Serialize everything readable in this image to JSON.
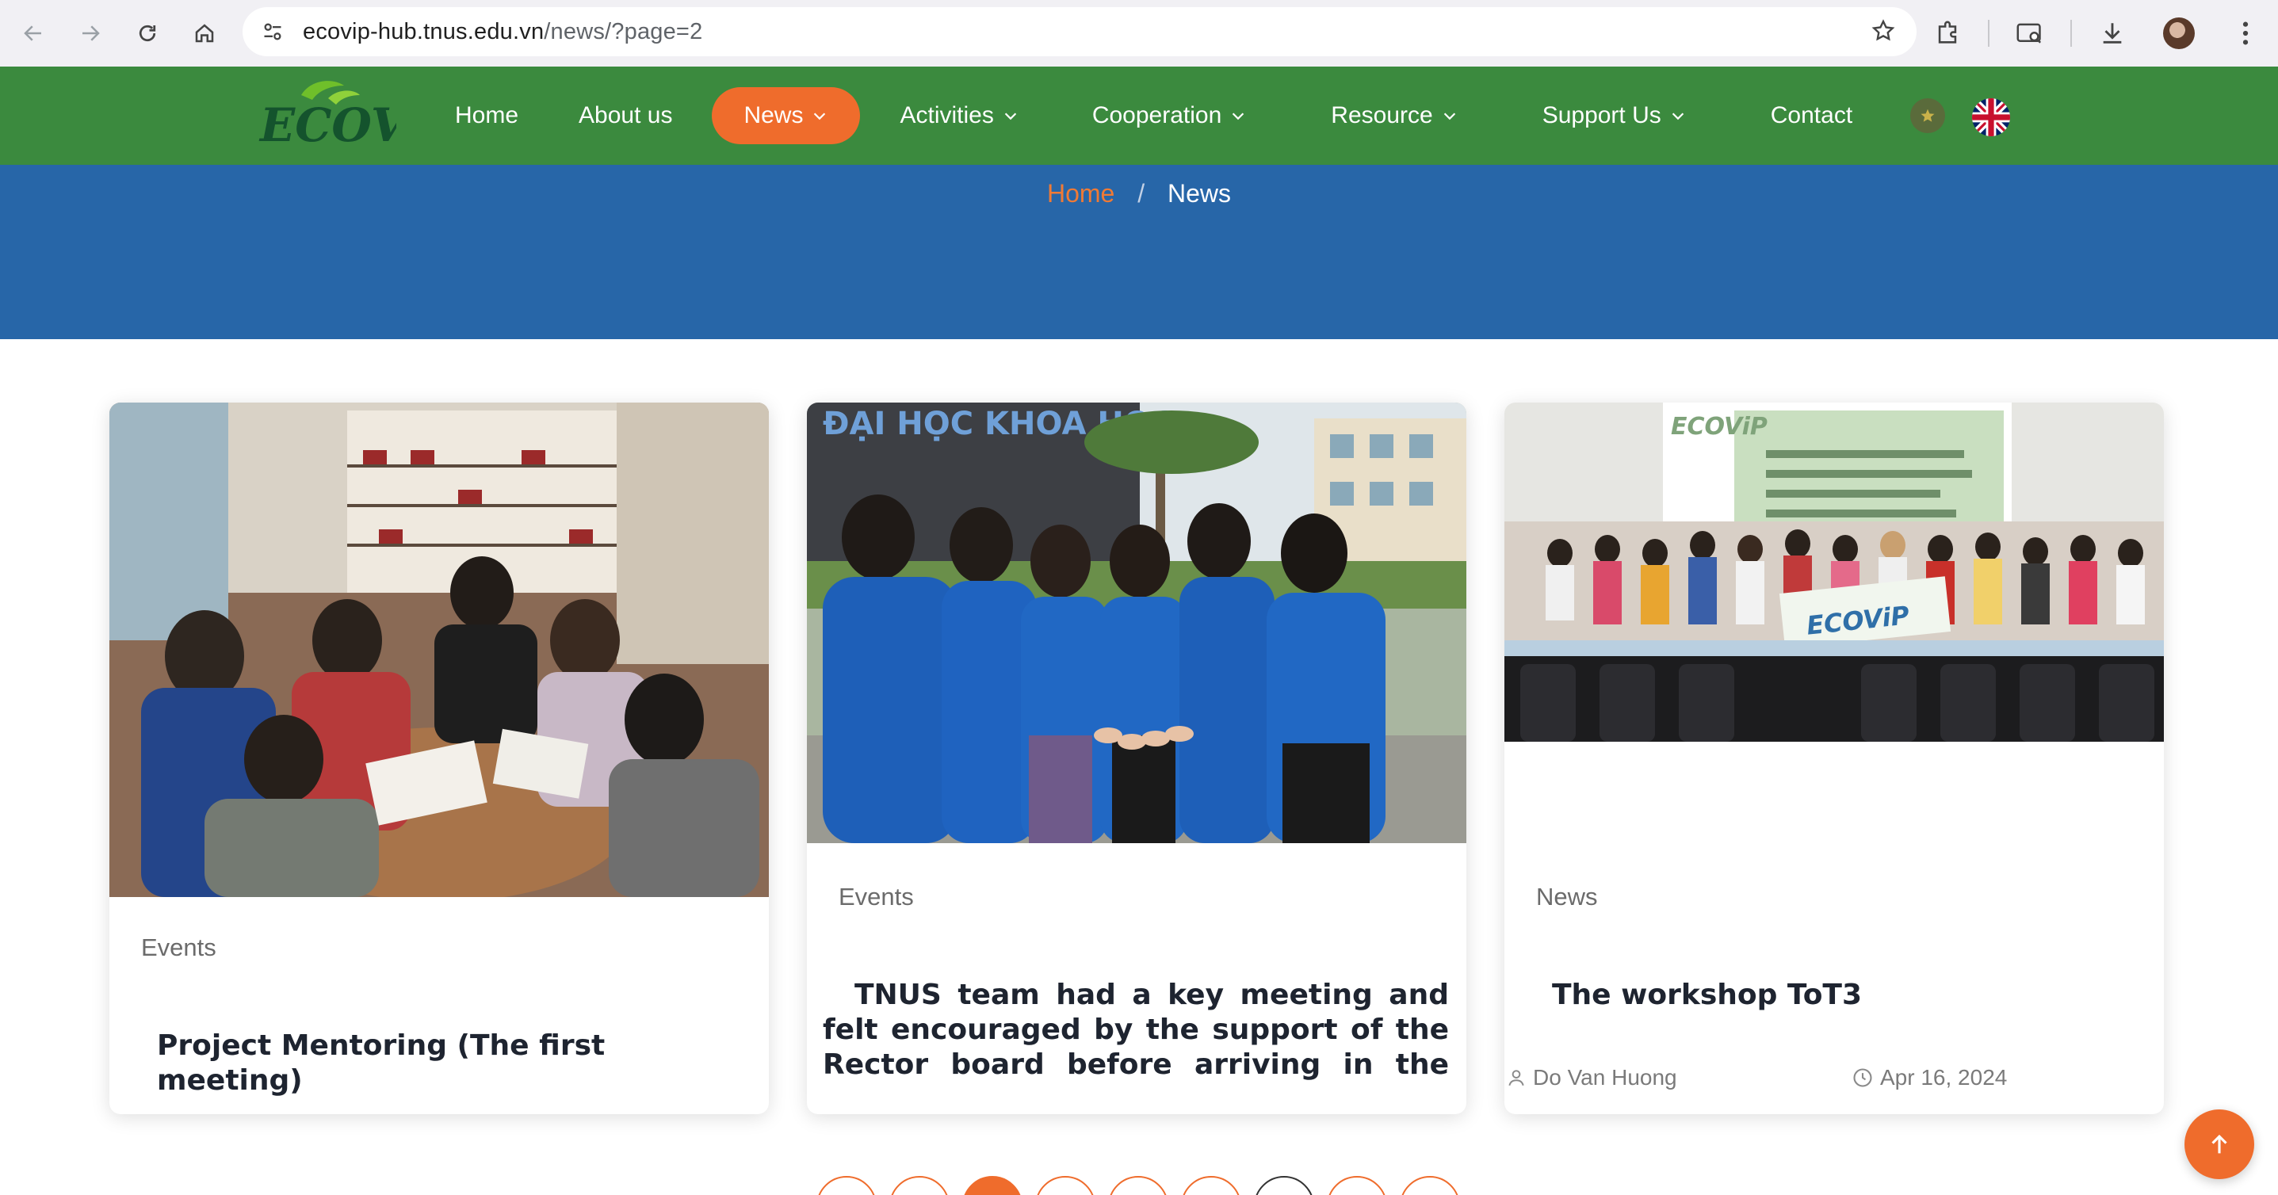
{
  "browser": {
    "url_host": "ecovip-hub.tnus.edu.vn",
    "url_path": "/news/?page=2"
  },
  "nav": {
    "logo_text": "ECOViP",
    "items": [
      {
        "label": "Home",
        "has_dropdown": false,
        "active": false
      },
      {
        "label": "About us",
        "has_dropdown": false,
        "active": false
      },
      {
        "label": "News",
        "has_dropdown": true,
        "active": true
      },
      {
        "label": "Activities",
        "has_dropdown": true,
        "active": false
      },
      {
        "label": "Cooperation",
        "has_dropdown": true,
        "active": false
      },
      {
        "label": "Resource",
        "has_dropdown": true,
        "active": false
      },
      {
        "label": "Support Us",
        "has_dropdown": true,
        "active": false
      },
      {
        "label": "Contact",
        "has_dropdown": false,
        "active": false
      }
    ]
  },
  "breadcrumb": {
    "home": "Home",
    "separator": "/",
    "current": "News"
  },
  "cards": [
    {
      "category": "Events",
      "title": "Project Mentoring (The first meeting)"
    },
    {
      "category": "Events",
      "title": "TNUS team had a key meeting and felt encouraged by the support of the Rector board before arriving in the beautiful city of"
    },
    {
      "category": "News",
      "title": "The workshop ToT3",
      "author": "Do Van Huong",
      "date": "Apr 16, 2024",
      "banner_text": "ECOViP"
    }
  ],
  "colors": {
    "nav_green": "#3b8a3e",
    "banner_blue": "#2766a8",
    "accent_orange": "#ef6c2c"
  }
}
